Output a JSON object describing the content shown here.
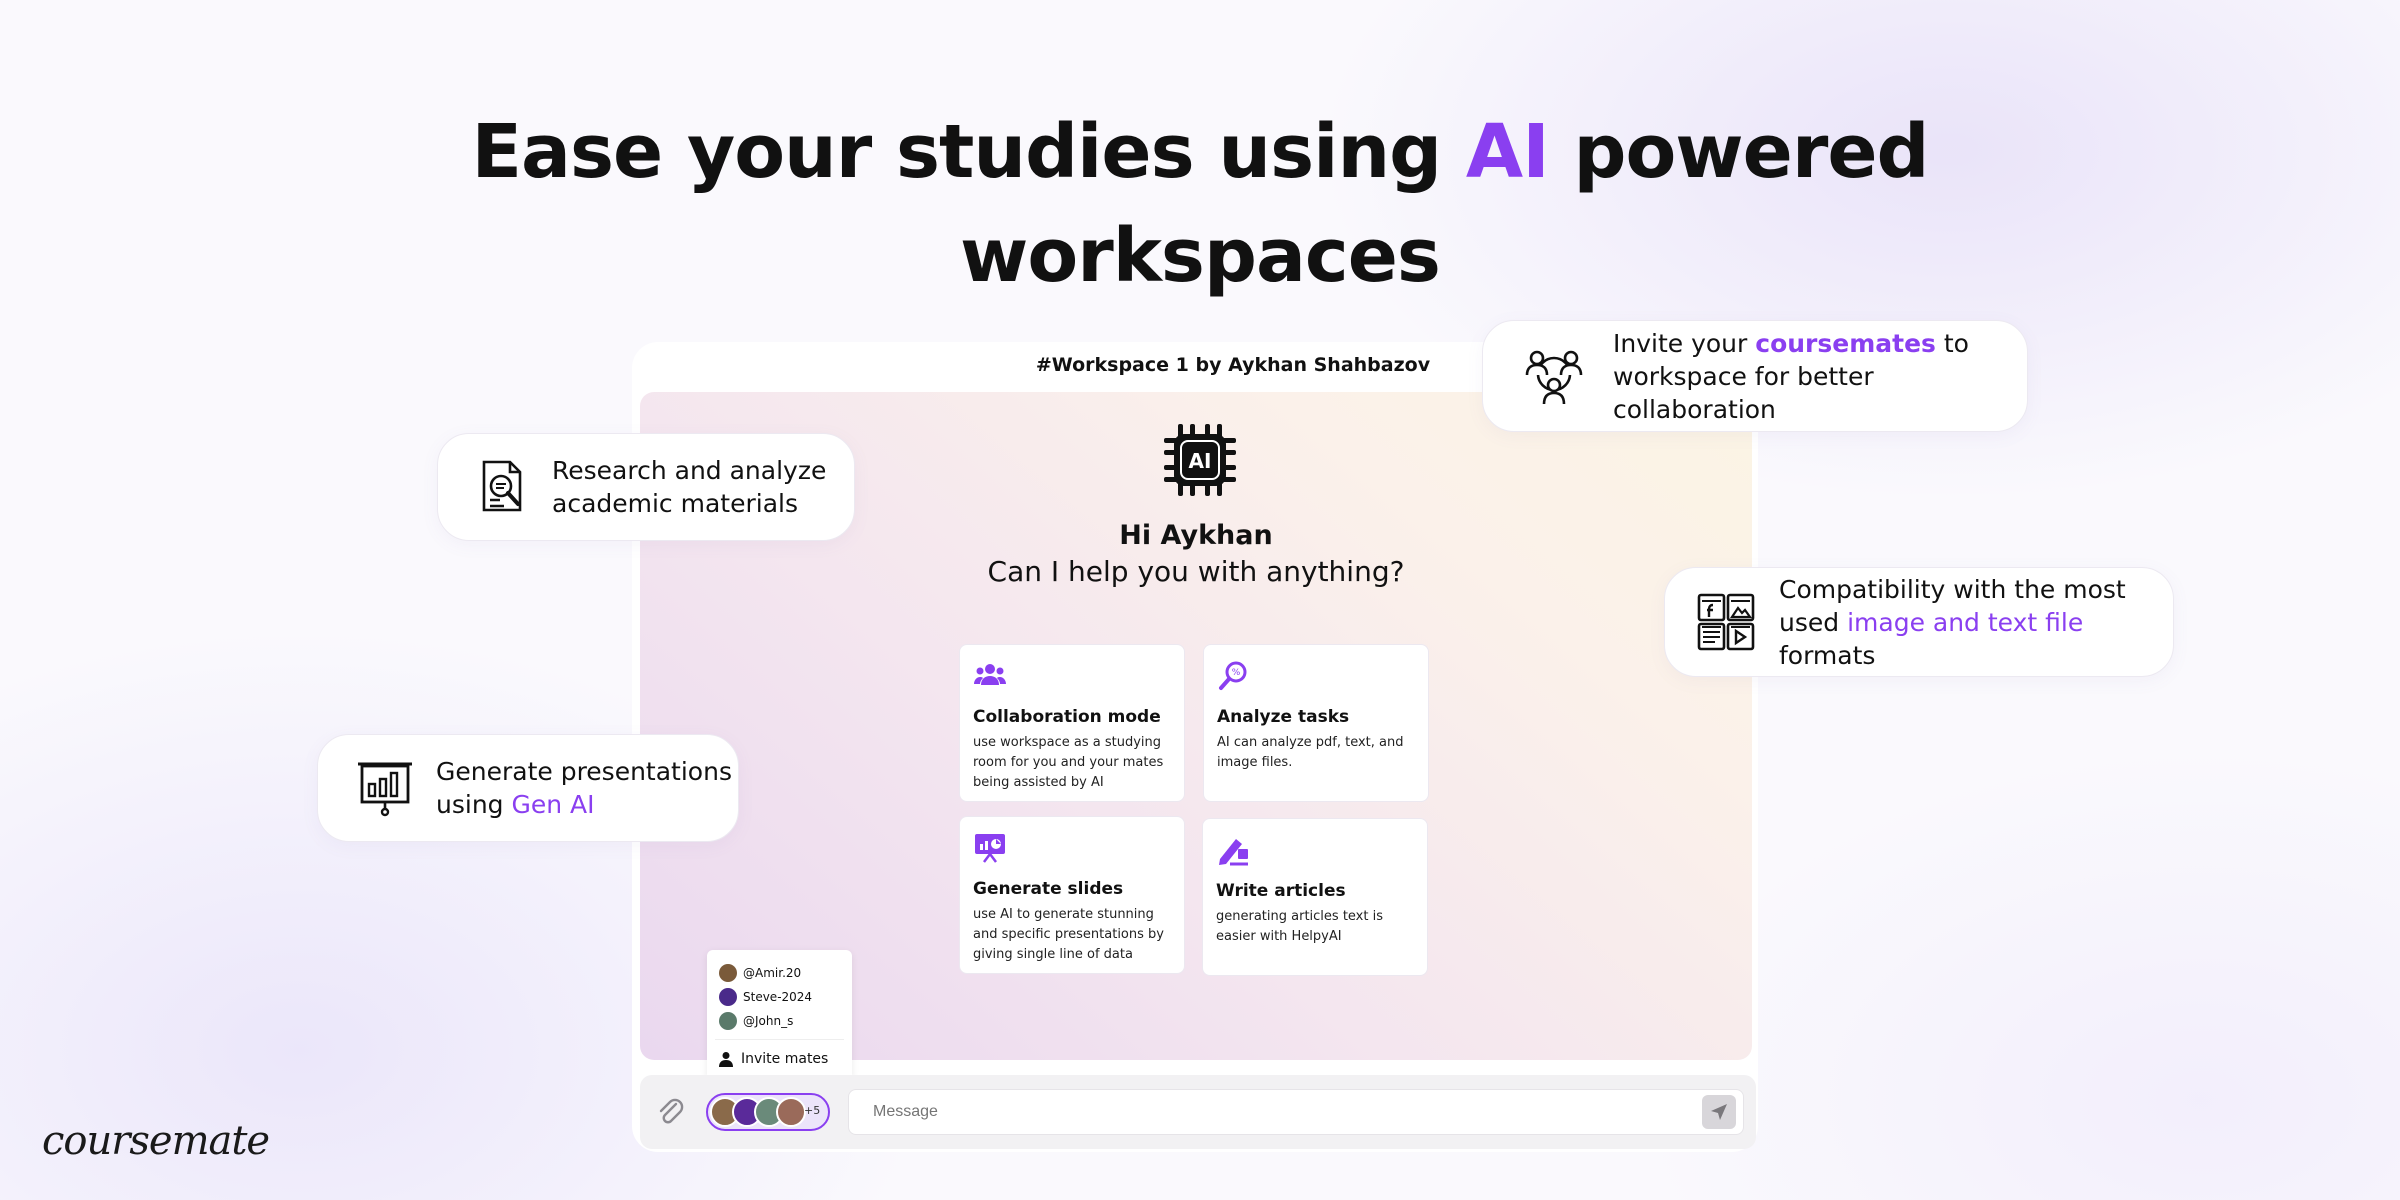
{
  "headline": {
    "part1": "Ease your studies using ",
    "accent": "AI",
    "part2": " powered",
    "line2": "workspaces"
  },
  "workspace": {
    "title": "#Workspace 1 by Aykhan Shahbazov",
    "logo_text": "AI",
    "greeting_name": "Hi Aykhan",
    "greeting_question": "Can I help you with anything?",
    "cards": [
      {
        "title": "Collaboration mode",
        "desc": "use workspace as a studying room for you and your mates being assisted by AI",
        "icon": "people-icon"
      },
      {
        "title": "Analyze tasks",
        "desc": "AI can analyze pdf, text, and image files.",
        "icon": "magnifier-icon"
      },
      {
        "title": "Generate slides",
        "desc": "use AI to generate stunning and specific presentations by giving single line of data",
        "icon": "presentation-icon"
      },
      {
        "title": "Write articles",
        "desc": "generating articles text is easier with HelpyAI",
        "icon": "writing-icon"
      }
    ]
  },
  "mates": {
    "list": [
      "@Amir.20",
      "Steve-2024",
      "@John_s"
    ],
    "invite_label": "Invite mates",
    "more_count": "+5"
  },
  "message": {
    "placeholder": "Message"
  },
  "features": {
    "research": {
      "text": "Research and analyze academic materials",
      "icon": "document-search-icon"
    },
    "presentations": {
      "text1": "Generate presentations using ",
      "highlight": "Gen AI",
      "icon": "presentation-board-icon"
    },
    "invite": {
      "text1": "Invite your ",
      "highlight": "coursemates",
      "text2": " to workspace for better collaboration",
      "icon": "team-icon"
    },
    "compat": {
      "text1": "Compatibility with the most used ",
      "highlight": "image and text file",
      "text2": " formats",
      "icon": "file-formats-icon"
    }
  },
  "brand": "coursemate",
  "colors": {
    "accent": "#8a3ff0"
  }
}
